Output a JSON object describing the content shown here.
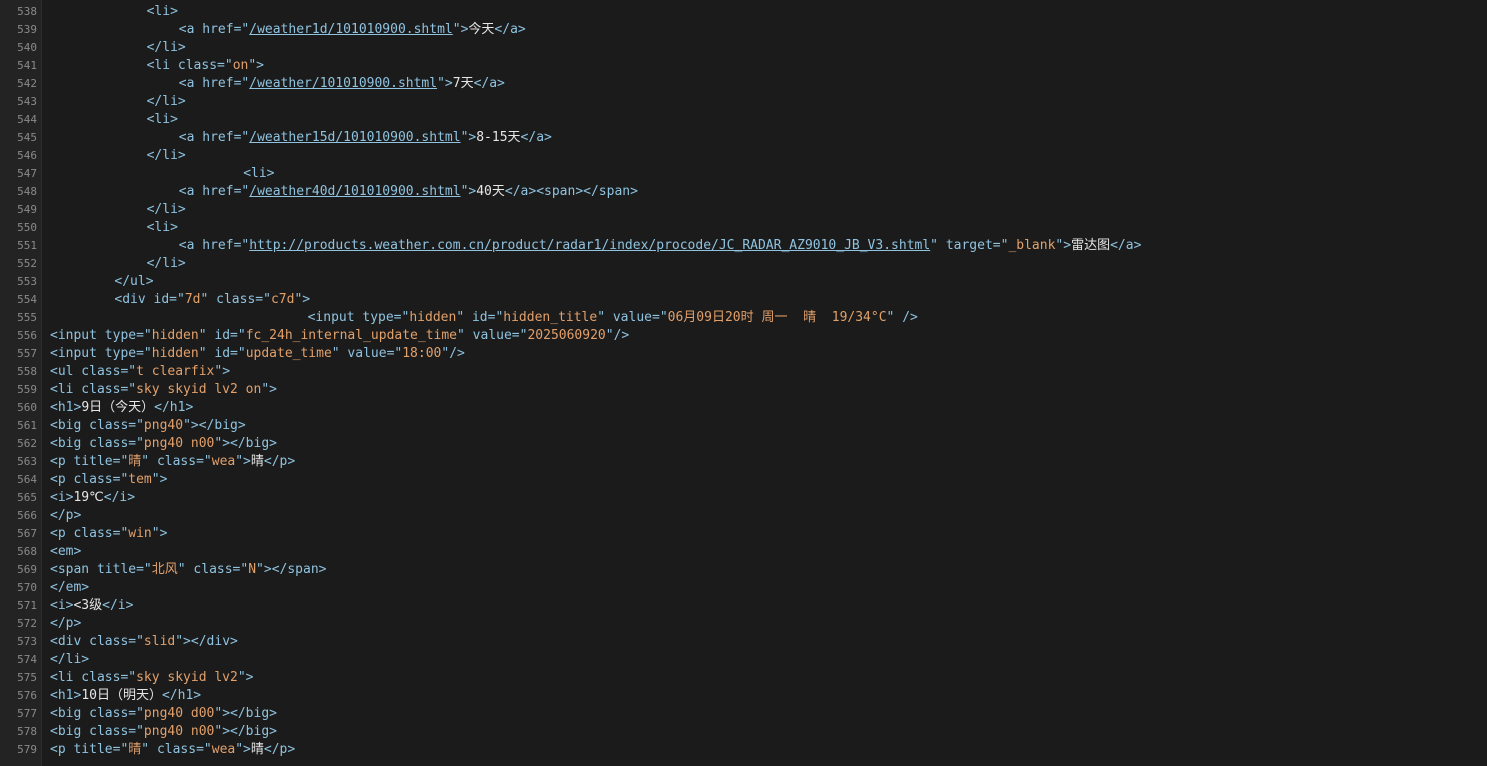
{
  "lines": [
    {
      "num": "538",
      "indent": 12,
      "tokens": [
        {
          "k": "t",
          "v": "<li>"
        }
      ]
    },
    {
      "num": "539",
      "indent": 16,
      "tokens": [
        {
          "k": "t",
          "v": "<a href=\""
        },
        {
          "k": "u",
          "v": "/weather1d/101010900.shtml"
        },
        {
          "k": "t",
          "v": "\">"
        },
        {
          "k": "x",
          "v": "今天"
        },
        {
          "k": "t",
          "v": "</a>"
        }
      ]
    },
    {
      "num": "540",
      "indent": 12,
      "tokens": [
        {
          "k": "t",
          "v": "</li>"
        }
      ]
    },
    {
      "num": "541",
      "indent": 12,
      "tokens": [
        {
          "k": "t",
          "v": "<li class=\""
        },
        {
          "k": "s",
          "v": "on"
        },
        {
          "k": "t",
          "v": "\">"
        }
      ]
    },
    {
      "num": "542",
      "indent": 16,
      "tokens": [
        {
          "k": "t",
          "v": "<a href=\""
        },
        {
          "k": "u",
          "v": "/weather/101010900.shtml"
        },
        {
          "k": "t",
          "v": "\">"
        },
        {
          "k": "x",
          "v": "7天"
        },
        {
          "k": "t",
          "v": "</a>"
        }
      ]
    },
    {
      "num": "543",
      "indent": 12,
      "tokens": [
        {
          "k": "t",
          "v": "</li>"
        }
      ]
    },
    {
      "num": "544",
      "indent": 12,
      "tokens": [
        {
          "k": "t",
          "v": "<li>"
        }
      ]
    },
    {
      "num": "545",
      "indent": 16,
      "tokens": [
        {
          "k": "t",
          "v": "<a href=\""
        },
        {
          "k": "u",
          "v": "/weather15d/101010900.shtml"
        },
        {
          "k": "t",
          "v": "\">"
        },
        {
          "k": "x",
          "v": "8-15天"
        },
        {
          "k": "t",
          "v": "</a>"
        }
      ]
    },
    {
      "num": "546",
      "indent": 12,
      "tokens": [
        {
          "k": "t",
          "v": "</li>"
        }
      ]
    },
    {
      "num": "547",
      "indent": 24,
      "tokens": [
        {
          "k": "t",
          "v": "<li>"
        }
      ]
    },
    {
      "num": "548",
      "indent": 16,
      "tokens": [
        {
          "k": "t",
          "v": "<a href=\""
        },
        {
          "k": "u",
          "v": "/weather40d/101010900.shtml"
        },
        {
          "k": "t",
          "v": "\">"
        },
        {
          "k": "x",
          "v": "40天"
        },
        {
          "k": "t",
          "v": "</a><span></span>"
        }
      ]
    },
    {
      "num": "549",
      "indent": 12,
      "tokens": [
        {
          "k": "t",
          "v": "</li>"
        }
      ]
    },
    {
      "num": "550",
      "indent": 12,
      "tokens": [
        {
          "k": "t",
          "v": "<li>"
        }
      ]
    },
    {
      "num": "551",
      "indent": 16,
      "tokens": [
        {
          "k": "t",
          "v": "<a href=\""
        },
        {
          "k": "u",
          "v": "http://products.weather.com.cn/product/radar1/index/procode/JC_RADAR_AZ9010_JB_V3.shtml"
        },
        {
          "k": "t",
          "v": "\" target=\""
        },
        {
          "k": "s",
          "v": "_blank"
        },
        {
          "k": "t",
          "v": "\">"
        },
        {
          "k": "x",
          "v": "雷达图"
        },
        {
          "k": "t",
          "v": "</a>"
        }
      ]
    },
    {
      "num": "552",
      "indent": 12,
      "tokens": [
        {
          "k": "t",
          "v": "</li>"
        }
      ]
    },
    {
      "num": "553",
      "indent": 8,
      "tokens": [
        {
          "k": "t",
          "v": "</ul>"
        }
      ]
    },
    {
      "num": "554",
      "indent": 8,
      "tokens": [
        {
          "k": "t",
          "v": "<div id=\""
        },
        {
          "k": "s",
          "v": "7d"
        },
        {
          "k": "t",
          "v": "\" class=\""
        },
        {
          "k": "s",
          "v": "c7d"
        },
        {
          "k": "t",
          "v": "\">"
        }
      ]
    },
    {
      "num": "555",
      "indent": 32,
      "tokens": [
        {
          "k": "t",
          "v": "<input type=\""
        },
        {
          "k": "s",
          "v": "hidden"
        },
        {
          "k": "t",
          "v": "\" id=\""
        },
        {
          "k": "s",
          "v": "hidden_title"
        },
        {
          "k": "t",
          "v": "\" value=\""
        },
        {
          "k": "s",
          "v": "06月09日20时 周一  晴  19/34°C"
        },
        {
          "k": "t",
          "v": "\" />"
        }
      ]
    },
    {
      "num": "556",
      "indent": 0,
      "tokens": [
        {
          "k": "t",
          "v": "<input type=\""
        },
        {
          "k": "s",
          "v": "hidden"
        },
        {
          "k": "t",
          "v": "\" id=\""
        },
        {
          "k": "s",
          "v": "fc_24h_internal_update_time"
        },
        {
          "k": "t",
          "v": "\" value=\""
        },
        {
          "k": "s",
          "v": "2025060920"
        },
        {
          "k": "t",
          "v": "\"/>"
        }
      ]
    },
    {
      "num": "557",
      "indent": 0,
      "tokens": [
        {
          "k": "t",
          "v": "<input type=\""
        },
        {
          "k": "s",
          "v": "hidden"
        },
        {
          "k": "t",
          "v": "\" id=\""
        },
        {
          "k": "s",
          "v": "update_time"
        },
        {
          "k": "t",
          "v": "\" value=\""
        },
        {
          "k": "s",
          "v": "18:00"
        },
        {
          "k": "t",
          "v": "\"/>"
        }
      ]
    },
    {
      "num": "558",
      "indent": 0,
      "tokens": [
        {
          "k": "t",
          "v": "<ul class=\""
        },
        {
          "k": "s",
          "v": "t clearfix"
        },
        {
          "k": "t",
          "v": "\">"
        }
      ]
    },
    {
      "num": "559",
      "indent": 0,
      "tokens": [
        {
          "k": "t",
          "v": "<li class=\""
        },
        {
          "k": "s",
          "v": "sky skyid lv2 on"
        },
        {
          "k": "t",
          "v": "\">"
        }
      ]
    },
    {
      "num": "560",
      "indent": 0,
      "tokens": [
        {
          "k": "t",
          "v": "<h1>"
        },
        {
          "k": "x",
          "v": "9日（今天）"
        },
        {
          "k": "t",
          "v": "</h1>"
        }
      ]
    },
    {
      "num": "561",
      "indent": 0,
      "tokens": [
        {
          "k": "t",
          "v": "<big class=\""
        },
        {
          "k": "s",
          "v": "png40"
        },
        {
          "k": "t",
          "v": "\"></big>"
        }
      ]
    },
    {
      "num": "562",
      "indent": 0,
      "tokens": [
        {
          "k": "t",
          "v": "<big class=\""
        },
        {
          "k": "s",
          "v": "png40 n00"
        },
        {
          "k": "t",
          "v": "\"></big>"
        }
      ]
    },
    {
      "num": "563",
      "indent": 0,
      "tokens": [
        {
          "k": "t",
          "v": "<p title=\""
        },
        {
          "k": "s",
          "v": "晴"
        },
        {
          "k": "t",
          "v": "\" class=\""
        },
        {
          "k": "s",
          "v": "wea"
        },
        {
          "k": "t",
          "v": "\">"
        },
        {
          "k": "x",
          "v": "晴"
        },
        {
          "k": "t",
          "v": "</p>"
        }
      ]
    },
    {
      "num": "564",
      "indent": 0,
      "tokens": [
        {
          "k": "t",
          "v": "<p class=\""
        },
        {
          "k": "s",
          "v": "tem"
        },
        {
          "k": "t",
          "v": "\">"
        }
      ]
    },
    {
      "num": "565",
      "indent": 0,
      "tokens": [
        {
          "k": "t",
          "v": "<i>"
        },
        {
          "k": "x",
          "v": "19℃"
        },
        {
          "k": "t",
          "v": "</i>"
        }
      ]
    },
    {
      "num": "566",
      "indent": 0,
      "tokens": [
        {
          "k": "t",
          "v": "</p>"
        }
      ]
    },
    {
      "num": "567",
      "indent": 0,
      "tokens": [
        {
          "k": "t",
          "v": "<p class=\""
        },
        {
          "k": "s",
          "v": "win"
        },
        {
          "k": "t",
          "v": "\">"
        }
      ]
    },
    {
      "num": "568",
      "indent": 0,
      "tokens": [
        {
          "k": "t",
          "v": "<em>"
        }
      ]
    },
    {
      "num": "569",
      "indent": 0,
      "tokens": [
        {
          "k": "t",
          "v": "<span title=\""
        },
        {
          "k": "s",
          "v": "北风"
        },
        {
          "k": "t",
          "v": "\" class=\""
        },
        {
          "k": "s",
          "v": "N"
        },
        {
          "k": "t",
          "v": "\"></span>"
        }
      ]
    },
    {
      "num": "570",
      "indent": 0,
      "tokens": [
        {
          "k": "t",
          "v": "</em>"
        }
      ]
    },
    {
      "num": "571",
      "indent": 0,
      "tokens": [
        {
          "k": "t",
          "v": "<i>"
        },
        {
          "k": "x",
          "v": "<3级"
        },
        {
          "k": "t",
          "v": "</i>"
        }
      ]
    },
    {
      "num": "572",
      "indent": 0,
      "tokens": [
        {
          "k": "t",
          "v": "</p>"
        }
      ]
    },
    {
      "num": "573",
      "indent": 0,
      "tokens": [
        {
          "k": "t",
          "v": "<div class=\""
        },
        {
          "k": "s",
          "v": "slid"
        },
        {
          "k": "t",
          "v": "\"></div>"
        }
      ]
    },
    {
      "num": "574",
      "indent": 0,
      "tokens": [
        {
          "k": "t",
          "v": "</li>"
        }
      ]
    },
    {
      "num": "575",
      "indent": 0,
      "tokens": [
        {
          "k": "t",
          "v": "<li class=\""
        },
        {
          "k": "s",
          "v": "sky skyid lv2"
        },
        {
          "k": "t",
          "v": "\">"
        }
      ]
    },
    {
      "num": "576",
      "indent": 0,
      "tokens": [
        {
          "k": "t",
          "v": "<h1>"
        },
        {
          "k": "x",
          "v": "10日（明天）"
        },
        {
          "k": "t",
          "v": "</h1>"
        }
      ]
    },
    {
      "num": "577",
      "indent": 0,
      "tokens": [
        {
          "k": "t",
          "v": "<big class=\""
        },
        {
          "k": "s",
          "v": "png40 d00"
        },
        {
          "k": "t",
          "v": "\"></big>"
        }
      ]
    },
    {
      "num": "578",
      "indent": 0,
      "tokens": [
        {
          "k": "t",
          "v": "<big class=\""
        },
        {
          "k": "s",
          "v": "png40 n00"
        },
        {
          "k": "t",
          "v": "\"></big>"
        }
      ]
    },
    {
      "num": "579",
      "indent": 0,
      "tokens": [
        {
          "k": "t",
          "v": "<p title=\""
        },
        {
          "k": "s",
          "v": "晴"
        },
        {
          "k": "t",
          "v": "\" class=\""
        },
        {
          "k": "s",
          "v": "wea"
        },
        {
          "k": "t",
          "v": "\">"
        },
        {
          "k": "x",
          "v": "晴"
        },
        {
          "k": "t",
          "v": "</p>"
        }
      ]
    }
  ]
}
